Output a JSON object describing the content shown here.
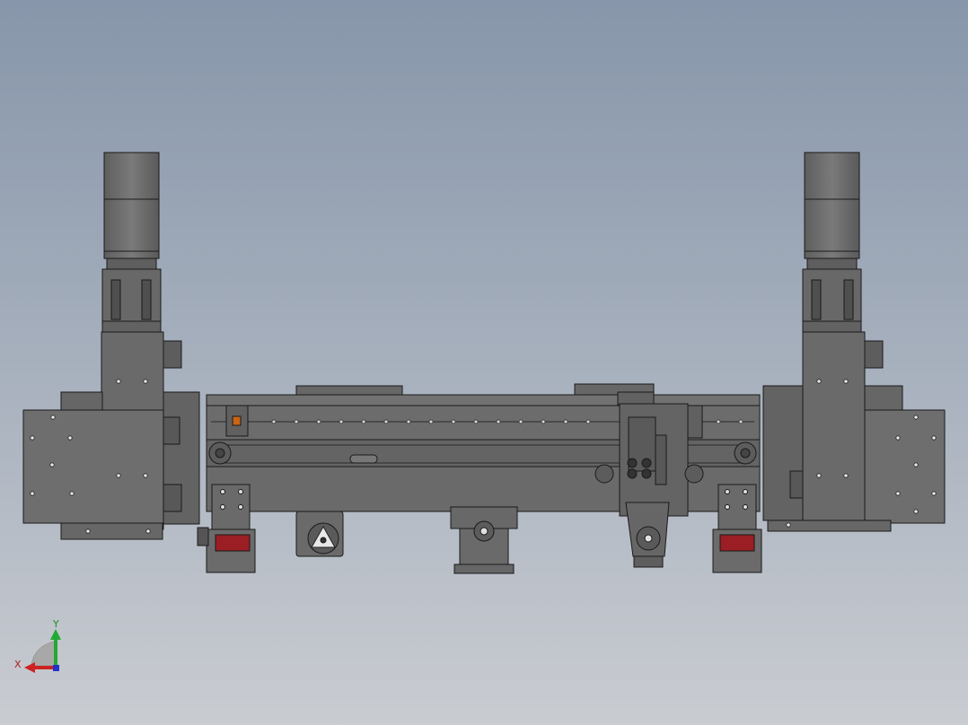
{
  "viewport": {
    "background_top": "#8796aa",
    "background_bottom": "#c9ccd1",
    "model_face_color": "#6b6b6b",
    "model_edge_color": "#1a1a1a",
    "guide_block_color": "#9a1e24"
  },
  "triad": {
    "x_label": "X",
    "y_label": "Y",
    "x_color": "#cc2222",
    "y_color": "#22aa33",
    "z_color": "#2233cc"
  },
  "icons": {
    "triad": "coordinate-triad-icon"
  }
}
